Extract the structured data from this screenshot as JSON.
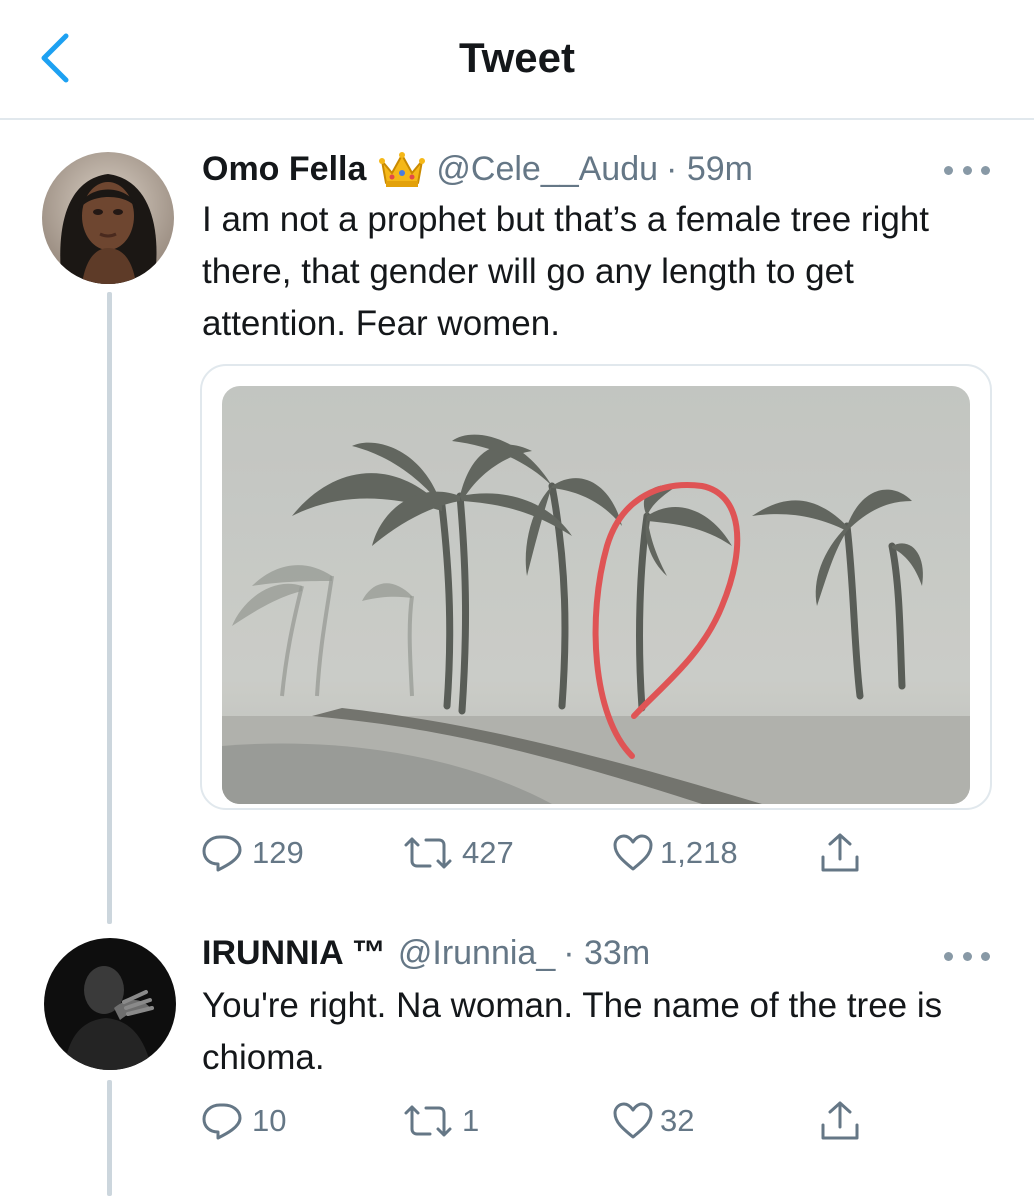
{
  "header": {
    "title": "Tweet",
    "back_icon": "chevron-left-icon"
  },
  "colors": {
    "accent": "#1da1f2",
    "text": "#14171a",
    "secondary": "#657786",
    "divider": "#e1e8ed",
    "thread_line": "#ccd6dd",
    "annotation_circle": "#e2383a"
  },
  "tweets": [
    {
      "name": "Omo Fella",
      "badge_icon": "crown-emoji-icon",
      "handle": "@Cele__Audu",
      "time": "· 59m",
      "text": "I am not a prophet but that’s a female tree right there, that gender will go any length to get attention. Fear women.",
      "media_icon": "palm-trees-storm-photo",
      "replies": "129",
      "retweets": "427",
      "likes": "1,218"
    },
    {
      "name": "IRUNNIA ™",
      "handle": "@Irunnia_",
      "time": "· 33m",
      "text": "You're right. Na woman. The name of the tree is chioma.",
      "replies": "10",
      "retweets": "1",
      "likes": "32"
    }
  ]
}
